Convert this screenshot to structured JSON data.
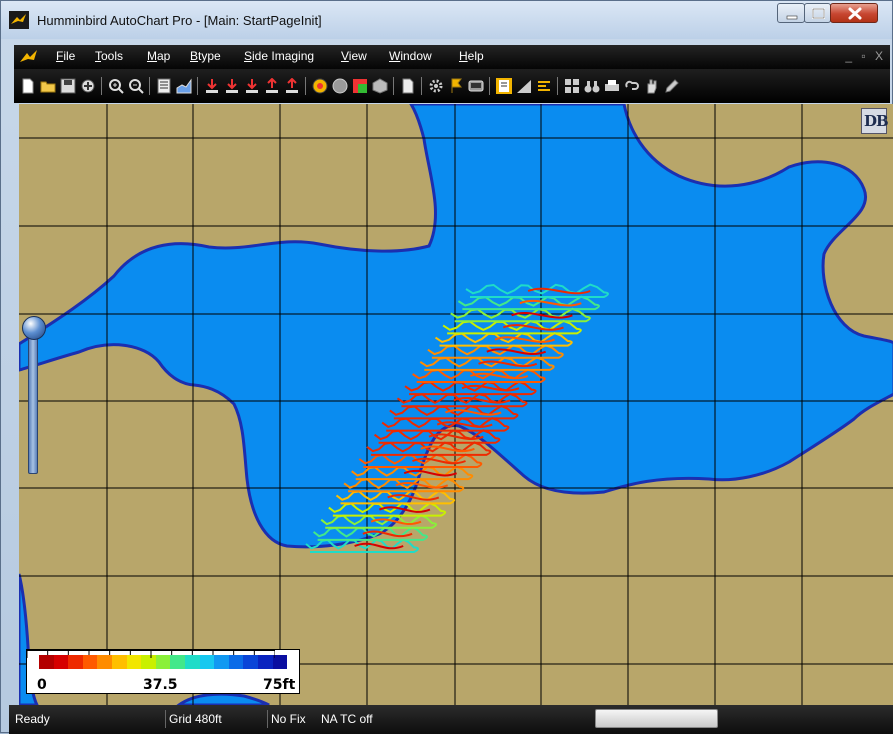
{
  "window": {
    "title": "Humminbird AutoChart Pro - [Main: StartPageInit]"
  },
  "menu": {
    "items": [
      "File",
      "Tools",
      "Map",
      "Btype",
      "Side Imaging",
      "View",
      "Window",
      "Help"
    ],
    "mdi_controls": "_ ▫ X"
  },
  "map": {
    "badge": "DB",
    "land_color": "#b8a66a",
    "water_color": "#0a8cf0",
    "shore_color": "#1b2fb0",
    "grid_color": "#000000"
  },
  "legend": {
    "min_label": "0",
    "mid_label": "37.5",
    "max_label": "75ft",
    "colors": [
      "#b30000",
      "#d60000",
      "#ee2a00",
      "#ff5a00",
      "#ff8c00",
      "#ffbf00",
      "#f2e600",
      "#c9f000",
      "#8af03a",
      "#42e88a",
      "#1fdcc8",
      "#17c8f0",
      "#1199f2",
      "#0b6ce8",
      "#0a45d8",
      "#0a24c0",
      "#0a0ea0"
    ]
  },
  "status": {
    "ready": "Ready",
    "grid": "Grid 480ft",
    "fix": "No Fix",
    "na_tc": "NA  TC off"
  }
}
